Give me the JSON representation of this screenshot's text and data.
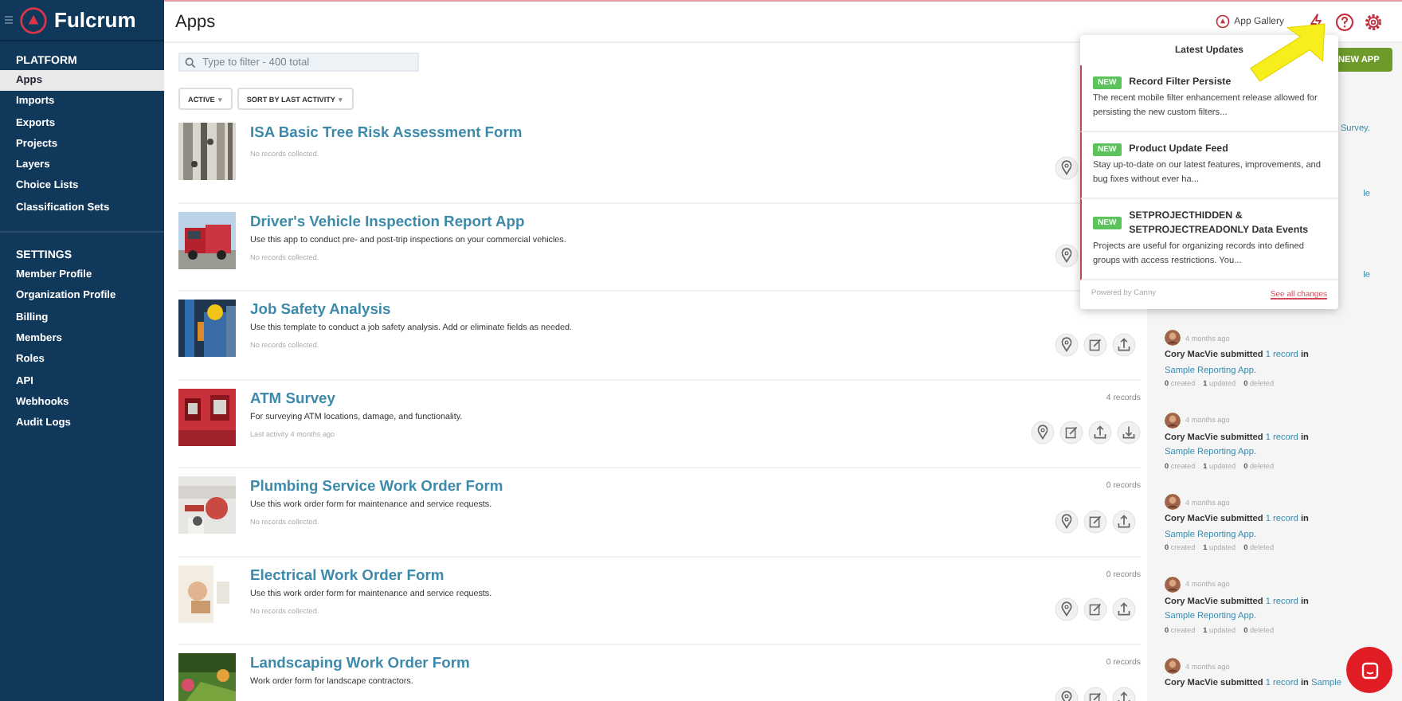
{
  "sidebar": {
    "brand": "Fulcrum",
    "sections": [
      {
        "title": "PLATFORM",
        "items": [
          {
            "label": "Apps",
            "selected": true
          },
          {
            "label": "Imports",
            "selected": false
          },
          {
            "label": "Exports",
            "selected": false
          },
          {
            "label": "Projects",
            "selected": false
          },
          {
            "label": "Layers",
            "selected": false
          },
          {
            "label": "Choice Lists",
            "selected": false
          },
          {
            "label": "Classification Sets",
            "selected": false
          }
        ]
      },
      {
        "title": "SETTINGS",
        "items": [
          {
            "label": "Member Profile",
            "selected": false
          },
          {
            "label": "Organization Profile",
            "selected": false
          },
          {
            "label": "Billing",
            "selected": false
          },
          {
            "label": "Members",
            "selected": false
          },
          {
            "label": "Roles",
            "selected": false
          },
          {
            "label": "API",
            "selected": false
          },
          {
            "label": "Webhooks",
            "selected": false
          },
          {
            "label": "Audit Logs",
            "selected": false
          }
        ]
      }
    ]
  },
  "header": {
    "title": "Apps",
    "gallery": "App Gallery"
  },
  "search": {
    "placeholder": "Type to filter - 400 total"
  },
  "filters": [
    {
      "label": "ACTIVE",
      "caret": "▾"
    },
    {
      "label": "SORT BY LAST ACTIVITY",
      "caret": "▾"
    }
  ],
  "new_app": "NEW APP",
  "apps": [
    {
      "title": "ISA Basic Tree Risk Assessment Form",
      "meta": "No records collected.",
      "actions": [
        {
          "kind": "map"
        }
      ]
    },
    {
      "title": "Driver's Vehicle Inspection Report App",
      "description": "Use this app to conduct pre- and post-trip inspections on your commercial vehicles.",
      "meta": "No records collected.",
      "actions": [
        {
          "kind": "map"
        }
      ]
    },
    {
      "title": "Job Safety Analysis",
      "description": "Use this template to conduct a job safety analysis. Add or eliminate fields as needed.",
      "meta": "No records collected.",
      "actions": [
        {
          "kind": "map"
        },
        {
          "kind": "edit"
        },
        {
          "kind": "upload"
        }
      ]
    },
    {
      "title": "ATM Survey",
      "description": "For surveying ATM locations, damage, and functionality.",
      "meta": "Last activity 4 months ago",
      "records": "4 records",
      "actions": [
        {
          "kind": "map"
        },
        {
          "kind": "edit"
        },
        {
          "kind": "upload"
        },
        {
          "kind": "download"
        }
      ]
    },
    {
      "title": "Plumbing Service Work Order Form",
      "description": "Use this work order form for maintenance and service requests.",
      "meta": "No records collected.",
      "records": "0 records",
      "actions": [
        {
          "kind": "map"
        },
        {
          "kind": "edit"
        },
        {
          "kind": "upload"
        }
      ]
    },
    {
      "title": "Electrical Work Order Form",
      "description": "Use this work order form for maintenance and service requests.",
      "meta": "No records collected.",
      "records": "0 records",
      "actions": [
        {
          "kind": "map"
        },
        {
          "kind": "edit"
        },
        {
          "kind": "upload"
        }
      ]
    },
    {
      "title": "Landscaping Work Order Form",
      "description": "Work order form for landscape contractors.",
      "records": "0 records",
      "actions": [
        {
          "kind": "map"
        },
        {
          "kind": "edit"
        },
        {
          "kind": "upload"
        }
      ]
    }
  ],
  "activity": {
    "fragments": [
      "Survey.",
      "le",
      "le"
    ],
    "items": [
      {
        "time": "4 months ago",
        "user": "Cory MacVie",
        "verb": "submitted",
        "count_link": "1 record",
        "prep": "in",
        "app_link": "Sample Reporting App.",
        "stats": [
          {
            "count": "0",
            "label": "created"
          },
          {
            "count": "1",
            "label": "updated"
          },
          {
            "count": "0",
            "label": "deleted"
          }
        ]
      },
      {
        "time": "4 months ago",
        "user": "Cory MacVie",
        "verb": "submitted",
        "count_link": "1 record",
        "prep": "in",
        "app_link": "Sample Reporting App.",
        "stats": [
          {
            "count": "0",
            "label": "created"
          },
          {
            "count": "1",
            "label": "updated"
          },
          {
            "count": "0",
            "label": "deleted"
          }
        ]
      },
      {
        "time": "4 months ago",
        "user": "Cory MacVie",
        "verb": "submitted",
        "count_link": "1 record",
        "prep": "in",
        "app_link": "Sample Reporting App.",
        "stats": [
          {
            "count": "0",
            "label": "created"
          },
          {
            "count": "1",
            "label": "updated"
          },
          {
            "count": "0",
            "label": "deleted"
          }
        ]
      },
      {
        "time": "4 months ago",
        "user": "Cory MacVie",
        "verb": "submitted",
        "count_link": "1 record",
        "prep": "in",
        "app_link": "Sample Reporting App.",
        "stats": [
          {
            "count": "0",
            "label": "created"
          },
          {
            "count": "1",
            "label": "updated"
          },
          {
            "count": "0",
            "label": "deleted"
          }
        ]
      },
      {
        "time": "4 months ago",
        "user": "Cory MacVie",
        "verb": "submitted",
        "count_link": "1 record",
        "prep": "in",
        "app_link": "Sample"
      }
    ]
  },
  "updates": {
    "title": "Latest Updates",
    "items": [
      {
        "badge": "NEW",
        "title": "Record Filter Persiste",
        "text": "The recent mobile filter enhancement release allowed for persisting the new custom filters..."
      },
      {
        "badge": "NEW",
        "title": "Product Update Feed",
        "text": "Stay up-to-date on our latest features, improvements, and bug fixes without ever ha..."
      },
      {
        "badge": "NEW",
        "title": "SETPROJECTHIDDEN & SETPROJECTREADONLY Data Events",
        "text": "Projects are useful for organizing records into defined groups with access restrictions. You..."
      }
    ],
    "powered": "Powered by Canny",
    "link": "See all changes"
  }
}
